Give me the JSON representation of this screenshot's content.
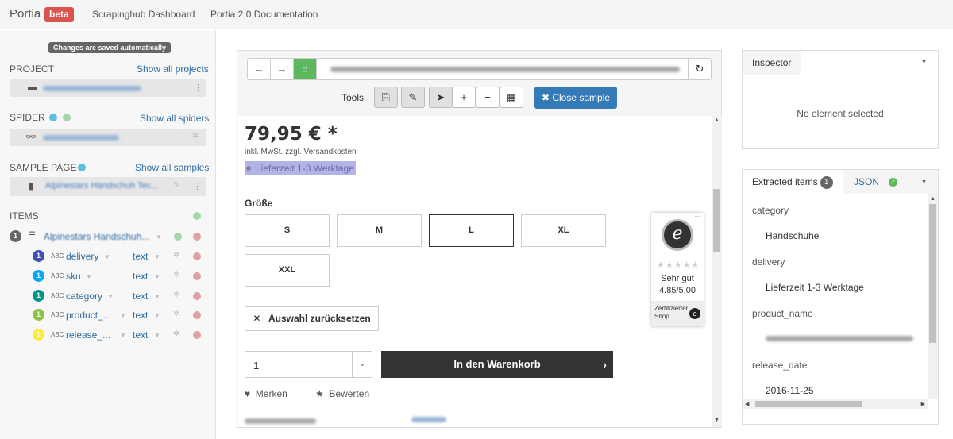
{
  "nav": {
    "brand": "Portia",
    "badge": "beta",
    "links": [
      "Scrapinghub Dashboard",
      "Portia 2.0 Documentation"
    ]
  },
  "sidebar": {
    "saved_notice": "Changes are saved automatically",
    "project": {
      "label": "PROJECT",
      "link": "Show all projects"
    },
    "spider": {
      "label": "SPIDER",
      "link": "Show all spiders"
    },
    "sample": {
      "label": "SAMPLE PAGE",
      "link": "Show all samples",
      "name": "Alpinestars Handschuh Tec..."
    },
    "items": {
      "label": "ITEMS",
      "root": {
        "count": "1",
        "name": "Alpinestars Handschuh..."
      },
      "fields": [
        {
          "count": "1",
          "type": "ABC",
          "name": "delivery",
          "kind": "text",
          "color": "#3f51b5"
        },
        {
          "count": "1",
          "type": "ABC",
          "name": "sku",
          "kind": "text",
          "color": "#03a9f4"
        },
        {
          "count": "1",
          "type": "ABC",
          "name": "category",
          "kind": "text",
          "color": "#009688"
        },
        {
          "count": "1",
          "type": "ABC",
          "name": "product_...",
          "kind": "text",
          "color": "#8bc34a"
        },
        {
          "count": "1",
          "type": "ABC",
          "name": "release_...",
          "kind": "text",
          "color": "#ffeb3b"
        }
      ]
    }
  },
  "browser": {
    "tools_label": "Tools",
    "close_sample": "Close sample",
    "page": {
      "price": "79,95 € *",
      "price_note": "inkl. MwSt. zzgl. Versandkosten",
      "delivery": "Lieferzeit 1-3 Werktage",
      "size_label": "Größe",
      "sizes": [
        "S",
        "M",
        "L",
        "XL",
        "XXL"
      ],
      "selected_size": "L",
      "reset": "Auswahl zurücksetzen",
      "quantity": "1",
      "cart": "In den Warenkorb",
      "remember": "Merken",
      "rate": "Bewerten",
      "trust": {
        "rating_text": "Sehr gut",
        "score": "4.85/5.00",
        "footer": "Zertifizierter Shop",
        "more": "..."
      }
    }
  },
  "inspector": {
    "title": "Inspector",
    "empty": "No element selected"
  },
  "extracted": {
    "tab": "Extracted items",
    "count": "1",
    "json_tab": "JSON",
    "rows": [
      {
        "key": "category",
        "value": "Handschuhe"
      },
      {
        "key": "delivery",
        "value": "Lieferzeit 1-3 Werktage"
      },
      {
        "key": "product_name",
        "value": ""
      },
      {
        "key": "release_date",
        "value": "2016-11-25"
      }
    ]
  },
  "colors": {
    "accent": "#337ab7",
    "beta": "#d9534f",
    "highlight": "#b3b3e6",
    "green": "#5cb85c"
  }
}
